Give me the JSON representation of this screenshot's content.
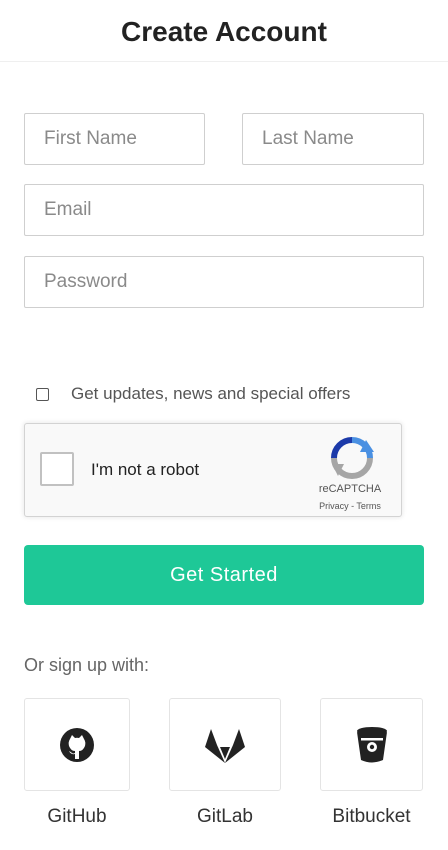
{
  "header": {
    "title": "Create Account"
  },
  "form": {
    "first_name": {
      "value": "",
      "placeholder": "First Name"
    },
    "last_name": {
      "value": "",
      "placeholder": "Last Name"
    },
    "email": {
      "value": "",
      "placeholder": "Email"
    },
    "password": {
      "value": "",
      "placeholder": "Password"
    },
    "optin": {
      "label": "Get updates, news and special offers",
      "checked": false
    },
    "recaptcha": {
      "label": "I'm not a robot",
      "brand": "reCAPTCHA",
      "links": "Privacy - Terms",
      "checked": false
    },
    "submit_label": "Get Started"
  },
  "social": {
    "heading": "Or sign up with:",
    "providers": [
      {
        "name": "GitHub",
        "icon": "github-icon"
      },
      {
        "name": "GitLab",
        "icon": "gitlab-icon"
      },
      {
        "name": "Bitbucket",
        "icon": "bitbucket-icon"
      }
    ]
  },
  "colors": {
    "accent": "#1ec897",
    "recaptcha_blue": "#4a90e2",
    "recaptcha_gray": "#a6a6a6"
  }
}
